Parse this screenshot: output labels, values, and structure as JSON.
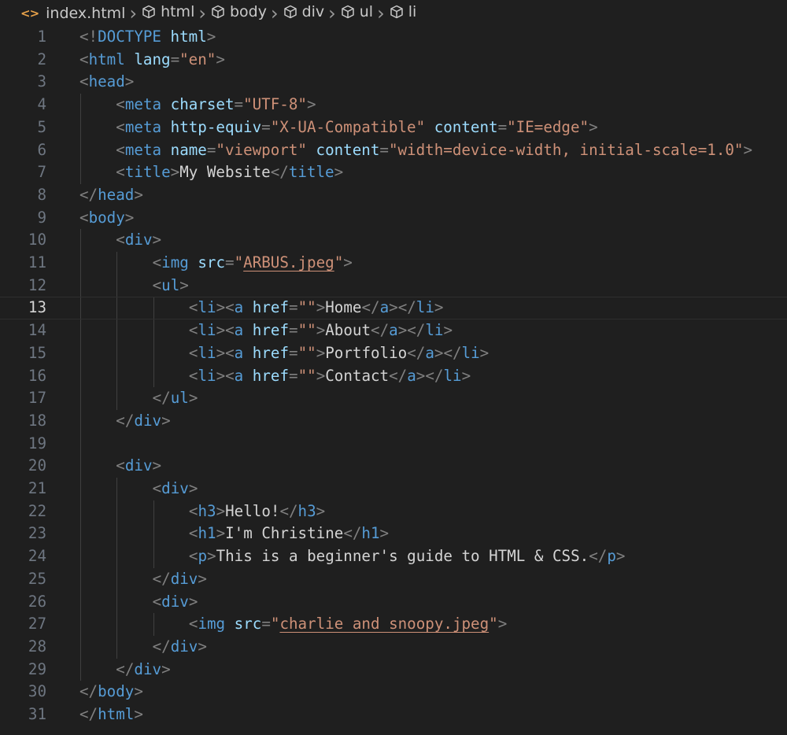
{
  "breadcrumb": {
    "file_icon": "<>",
    "file_name": "index.html",
    "items": [
      "html",
      "body",
      "div",
      "ul",
      "li"
    ]
  },
  "editor": {
    "current_line": 13,
    "lines": [
      {
        "n": "1",
        "indent": 0,
        "tokens": [
          [
            "p",
            "<!"
          ],
          [
            "t",
            "DOCTYPE"
          ],
          [
            "p",
            " "
          ],
          [
            "a",
            "html"
          ],
          [
            "p",
            ">"
          ]
        ]
      },
      {
        "n": "2",
        "indent": 0,
        "tokens": [
          [
            "p",
            "<"
          ],
          [
            "t",
            "html"
          ],
          [
            "x",
            " "
          ],
          [
            "a",
            "lang"
          ],
          [
            "p",
            "="
          ],
          [
            "s",
            "\"en\""
          ],
          [
            "p",
            ">"
          ]
        ]
      },
      {
        "n": "3",
        "indent": 0,
        "tokens": [
          [
            "p",
            "<"
          ],
          [
            "t",
            "head"
          ],
          [
            "p",
            ">"
          ]
        ]
      },
      {
        "n": "4",
        "indent": 1,
        "tokens": [
          [
            "p",
            "<"
          ],
          [
            "t",
            "meta"
          ],
          [
            "x",
            " "
          ],
          [
            "a",
            "charset"
          ],
          [
            "p",
            "="
          ],
          [
            "s",
            "\"UTF-8\""
          ],
          [
            "p",
            ">"
          ]
        ]
      },
      {
        "n": "5",
        "indent": 1,
        "tokens": [
          [
            "p",
            "<"
          ],
          [
            "t",
            "meta"
          ],
          [
            "x",
            " "
          ],
          [
            "a",
            "http-equiv"
          ],
          [
            "p",
            "="
          ],
          [
            "s",
            "\"X-UA-Compatible\""
          ],
          [
            "x",
            " "
          ],
          [
            "a",
            "content"
          ],
          [
            "p",
            "="
          ],
          [
            "s",
            "\"IE=edge\""
          ],
          [
            "p",
            ">"
          ]
        ]
      },
      {
        "n": "6",
        "indent": 1,
        "tokens": [
          [
            "p",
            "<"
          ],
          [
            "t",
            "meta"
          ],
          [
            "x",
            " "
          ],
          [
            "a",
            "name"
          ],
          [
            "p",
            "="
          ],
          [
            "s",
            "\"viewport\""
          ],
          [
            "x",
            " "
          ],
          [
            "a",
            "content"
          ],
          [
            "p",
            "="
          ],
          [
            "s",
            "\"width=device-width, initial-scale=1.0\""
          ],
          [
            "p",
            ">"
          ]
        ]
      },
      {
        "n": "7",
        "indent": 1,
        "tokens": [
          [
            "p",
            "<"
          ],
          [
            "t",
            "title"
          ],
          [
            "p",
            ">"
          ],
          [
            "x",
            "My Website"
          ],
          [
            "p",
            "</"
          ],
          [
            "t",
            "title"
          ],
          [
            "p",
            ">"
          ]
        ]
      },
      {
        "n": "8",
        "indent": 0,
        "tokens": [
          [
            "p",
            "</"
          ],
          [
            "t",
            "head"
          ],
          [
            "p",
            ">"
          ]
        ]
      },
      {
        "n": "9",
        "indent": 0,
        "tokens": [
          [
            "p",
            "<"
          ],
          [
            "t",
            "body"
          ],
          [
            "p",
            ">"
          ]
        ]
      },
      {
        "n": "10",
        "indent": 1,
        "tokens": [
          [
            "p",
            "<"
          ],
          [
            "t",
            "div"
          ],
          [
            "p",
            ">"
          ]
        ]
      },
      {
        "n": "11",
        "indent": 2,
        "tokens": [
          [
            "p",
            "<"
          ],
          [
            "t",
            "img"
          ],
          [
            "x",
            " "
          ],
          [
            "a",
            "src"
          ],
          [
            "p",
            "="
          ],
          [
            "s",
            "\""
          ],
          [
            "u",
            "ARBUS.jpeg"
          ],
          [
            "s",
            "\""
          ],
          [
            "p",
            ">"
          ]
        ]
      },
      {
        "n": "12",
        "indent": 2,
        "tokens": [
          [
            "p",
            "<"
          ],
          [
            "t",
            "ul"
          ],
          [
            "p",
            ">"
          ]
        ]
      },
      {
        "n": "13",
        "indent": 3,
        "tokens": [
          [
            "p",
            "<"
          ],
          [
            "t",
            "li"
          ],
          [
            "p",
            "><"
          ],
          [
            "t",
            "a"
          ],
          [
            "x",
            " "
          ],
          [
            "a",
            "href"
          ],
          [
            "p",
            "="
          ],
          [
            "s",
            "\"\""
          ],
          [
            "p",
            ">"
          ],
          [
            "x",
            "Home"
          ],
          [
            "p",
            "</"
          ],
          [
            "t",
            "a"
          ],
          [
            "p",
            "></"
          ],
          [
            "t",
            "li"
          ],
          [
            "p",
            ">"
          ]
        ]
      },
      {
        "n": "14",
        "indent": 3,
        "tokens": [
          [
            "p",
            "<"
          ],
          [
            "t",
            "li"
          ],
          [
            "p",
            "><"
          ],
          [
            "t",
            "a"
          ],
          [
            "x",
            " "
          ],
          [
            "a",
            "href"
          ],
          [
            "p",
            "="
          ],
          [
            "s",
            "\"\""
          ],
          [
            "p",
            ">"
          ],
          [
            "x",
            "About"
          ],
          [
            "p",
            "</"
          ],
          [
            "t",
            "a"
          ],
          [
            "p",
            "></"
          ],
          [
            "t",
            "li"
          ],
          [
            "p",
            ">"
          ]
        ]
      },
      {
        "n": "15",
        "indent": 3,
        "tokens": [
          [
            "p",
            "<"
          ],
          [
            "t",
            "li"
          ],
          [
            "p",
            "><"
          ],
          [
            "t",
            "a"
          ],
          [
            "x",
            " "
          ],
          [
            "a",
            "href"
          ],
          [
            "p",
            "="
          ],
          [
            "s",
            "\"\""
          ],
          [
            "p",
            ">"
          ],
          [
            "x",
            "Portfolio"
          ],
          [
            "p",
            "</"
          ],
          [
            "t",
            "a"
          ],
          [
            "p",
            "></"
          ],
          [
            "t",
            "li"
          ],
          [
            "p",
            ">"
          ]
        ]
      },
      {
        "n": "16",
        "indent": 3,
        "tokens": [
          [
            "p",
            "<"
          ],
          [
            "t",
            "li"
          ],
          [
            "p",
            "><"
          ],
          [
            "t",
            "a"
          ],
          [
            "x",
            " "
          ],
          [
            "a",
            "href"
          ],
          [
            "p",
            "="
          ],
          [
            "s",
            "\"\""
          ],
          [
            "p",
            ">"
          ],
          [
            "x",
            "Contact"
          ],
          [
            "p",
            "</"
          ],
          [
            "t",
            "a"
          ],
          [
            "p",
            "></"
          ],
          [
            "t",
            "li"
          ],
          [
            "p",
            ">"
          ]
        ]
      },
      {
        "n": "17",
        "indent": 2,
        "tokens": [
          [
            "p",
            "</"
          ],
          [
            "t",
            "ul"
          ],
          [
            "p",
            ">"
          ]
        ]
      },
      {
        "n": "18",
        "indent": 1,
        "tokens": [
          [
            "p",
            "</"
          ],
          [
            "t",
            "div"
          ],
          [
            "p",
            ">"
          ]
        ]
      },
      {
        "n": "19",
        "indent": 0,
        "tokens": []
      },
      {
        "n": "20",
        "indent": 1,
        "tokens": [
          [
            "p",
            "<"
          ],
          [
            "t",
            "div"
          ],
          [
            "p",
            ">"
          ]
        ]
      },
      {
        "n": "21",
        "indent": 2,
        "tokens": [
          [
            "p",
            "<"
          ],
          [
            "t",
            "div"
          ],
          [
            "p",
            ">"
          ]
        ]
      },
      {
        "n": "22",
        "indent": 3,
        "tokens": [
          [
            "p",
            "<"
          ],
          [
            "t",
            "h3"
          ],
          [
            "p",
            ">"
          ],
          [
            "x",
            "Hello!"
          ],
          [
            "p",
            "</"
          ],
          [
            "t",
            "h3"
          ],
          [
            "p",
            ">"
          ]
        ]
      },
      {
        "n": "23",
        "indent": 3,
        "tokens": [
          [
            "p",
            "<"
          ],
          [
            "t",
            "h1"
          ],
          [
            "p",
            ">"
          ],
          [
            "x",
            "I'm Christine"
          ],
          [
            "p",
            "</"
          ],
          [
            "t",
            "h1"
          ],
          [
            "p",
            ">"
          ]
        ]
      },
      {
        "n": "24",
        "indent": 3,
        "tokens": [
          [
            "p",
            "<"
          ],
          [
            "t",
            "p"
          ],
          [
            "p",
            ">"
          ],
          [
            "x",
            "This is a beginner's guide to HTML & CSS."
          ],
          [
            "p",
            "</"
          ],
          [
            "t",
            "p"
          ],
          [
            "p",
            ">"
          ]
        ]
      },
      {
        "n": "25",
        "indent": 2,
        "tokens": [
          [
            "p",
            "</"
          ],
          [
            "t",
            "div"
          ],
          [
            "p",
            ">"
          ]
        ]
      },
      {
        "n": "26",
        "indent": 2,
        "tokens": [
          [
            "p",
            "<"
          ],
          [
            "t",
            "div"
          ],
          [
            "p",
            ">"
          ]
        ]
      },
      {
        "n": "27",
        "indent": 3,
        "tokens": [
          [
            "p",
            "<"
          ],
          [
            "t",
            "img"
          ],
          [
            "x",
            " "
          ],
          [
            "a",
            "src"
          ],
          [
            "p",
            "="
          ],
          [
            "s",
            "\""
          ],
          [
            "u",
            "charlie and snoopy.jpeg"
          ],
          [
            "s",
            "\""
          ],
          [
            "p",
            ">"
          ]
        ]
      },
      {
        "n": "28",
        "indent": 2,
        "tokens": [
          [
            "p",
            "</"
          ],
          [
            "t",
            "div"
          ],
          [
            "p",
            ">"
          ]
        ]
      },
      {
        "n": "29",
        "indent": 1,
        "tokens": [
          [
            "p",
            "</"
          ],
          [
            "t",
            "div"
          ],
          [
            "p",
            ">"
          ]
        ]
      },
      {
        "n": "30",
        "indent": 0,
        "tokens": [
          [
            "p",
            "</"
          ],
          [
            "t",
            "body"
          ],
          [
            "p",
            ">"
          ]
        ]
      },
      {
        "n": "31",
        "indent": 0,
        "tokens": [
          [
            "p",
            "</"
          ],
          [
            "t",
            "html"
          ],
          [
            "p",
            ">"
          ]
        ]
      }
    ]
  },
  "colors": {
    "background": "#1f1f1f",
    "tag": "#569cd6",
    "attribute": "#9cdcfe",
    "string": "#ce9178",
    "text": "#d4d4d4",
    "punctuation": "#808080",
    "line_number": "#6e7681",
    "breadcrumb_file_icon": "#e8a24a"
  }
}
